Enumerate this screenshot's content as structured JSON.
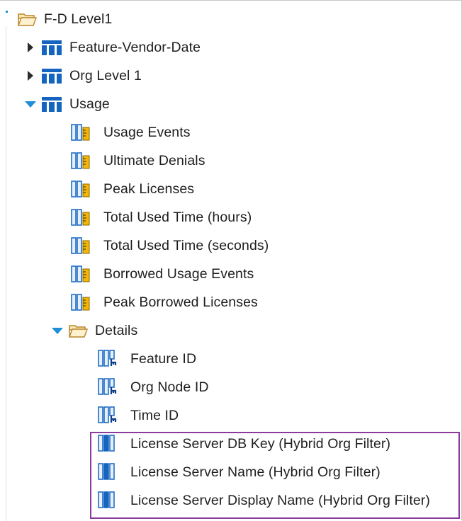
{
  "tree": {
    "root": {
      "label": "F-D Level1",
      "icon": "folder-open-icon"
    },
    "cubes": [
      {
        "label": "Feature-Vendor-Date",
        "icon": "table-icon",
        "expanded": false
      },
      {
        "label": "Org Level 1",
        "icon": "table-icon",
        "expanded": false
      },
      {
        "label": "Usage",
        "icon": "table-icon",
        "expanded": true
      }
    ],
    "measures": [
      {
        "label": "Usage Events",
        "icon": "measure-icon"
      },
      {
        "label": "Ultimate Denials",
        "icon": "measure-icon"
      },
      {
        "label": "Peak Licenses",
        "icon": "measure-icon"
      },
      {
        "label": "Total Used Time (hours)",
        "icon": "measure-icon"
      },
      {
        "label": "Total Used Time (seconds)",
        "icon": "measure-icon"
      },
      {
        "label": "Borrowed Usage Events",
        "icon": "measure-icon"
      },
      {
        "label": "Peak Borrowed Licenses",
        "icon": "measure-icon"
      }
    ],
    "details_folder": {
      "label": "Details",
      "icon": "folder-open-icon",
      "expanded": true
    },
    "detail_items": [
      {
        "label": "Feature ID",
        "icon": "key-column-icon"
      },
      {
        "label": "Org Node ID",
        "icon": "key-column-icon"
      },
      {
        "label": "Time ID",
        "icon": "key-column-icon"
      },
      {
        "label": "License Server DB Key (Hybrid Org Filter)",
        "icon": "column-icon"
      },
      {
        "label": "License Server Name (Hybrid Org Filter)",
        "icon": "column-icon"
      },
      {
        "label": "License Server Display Name (Hybrid Org Filter)",
        "icon": "column-icon"
      }
    ]
  },
  "colors": {
    "accent": "#1f8fd6",
    "table_icon": "#1565c0",
    "measure_yellow": "#e0a800",
    "highlight_border": "#8a3a9a"
  }
}
